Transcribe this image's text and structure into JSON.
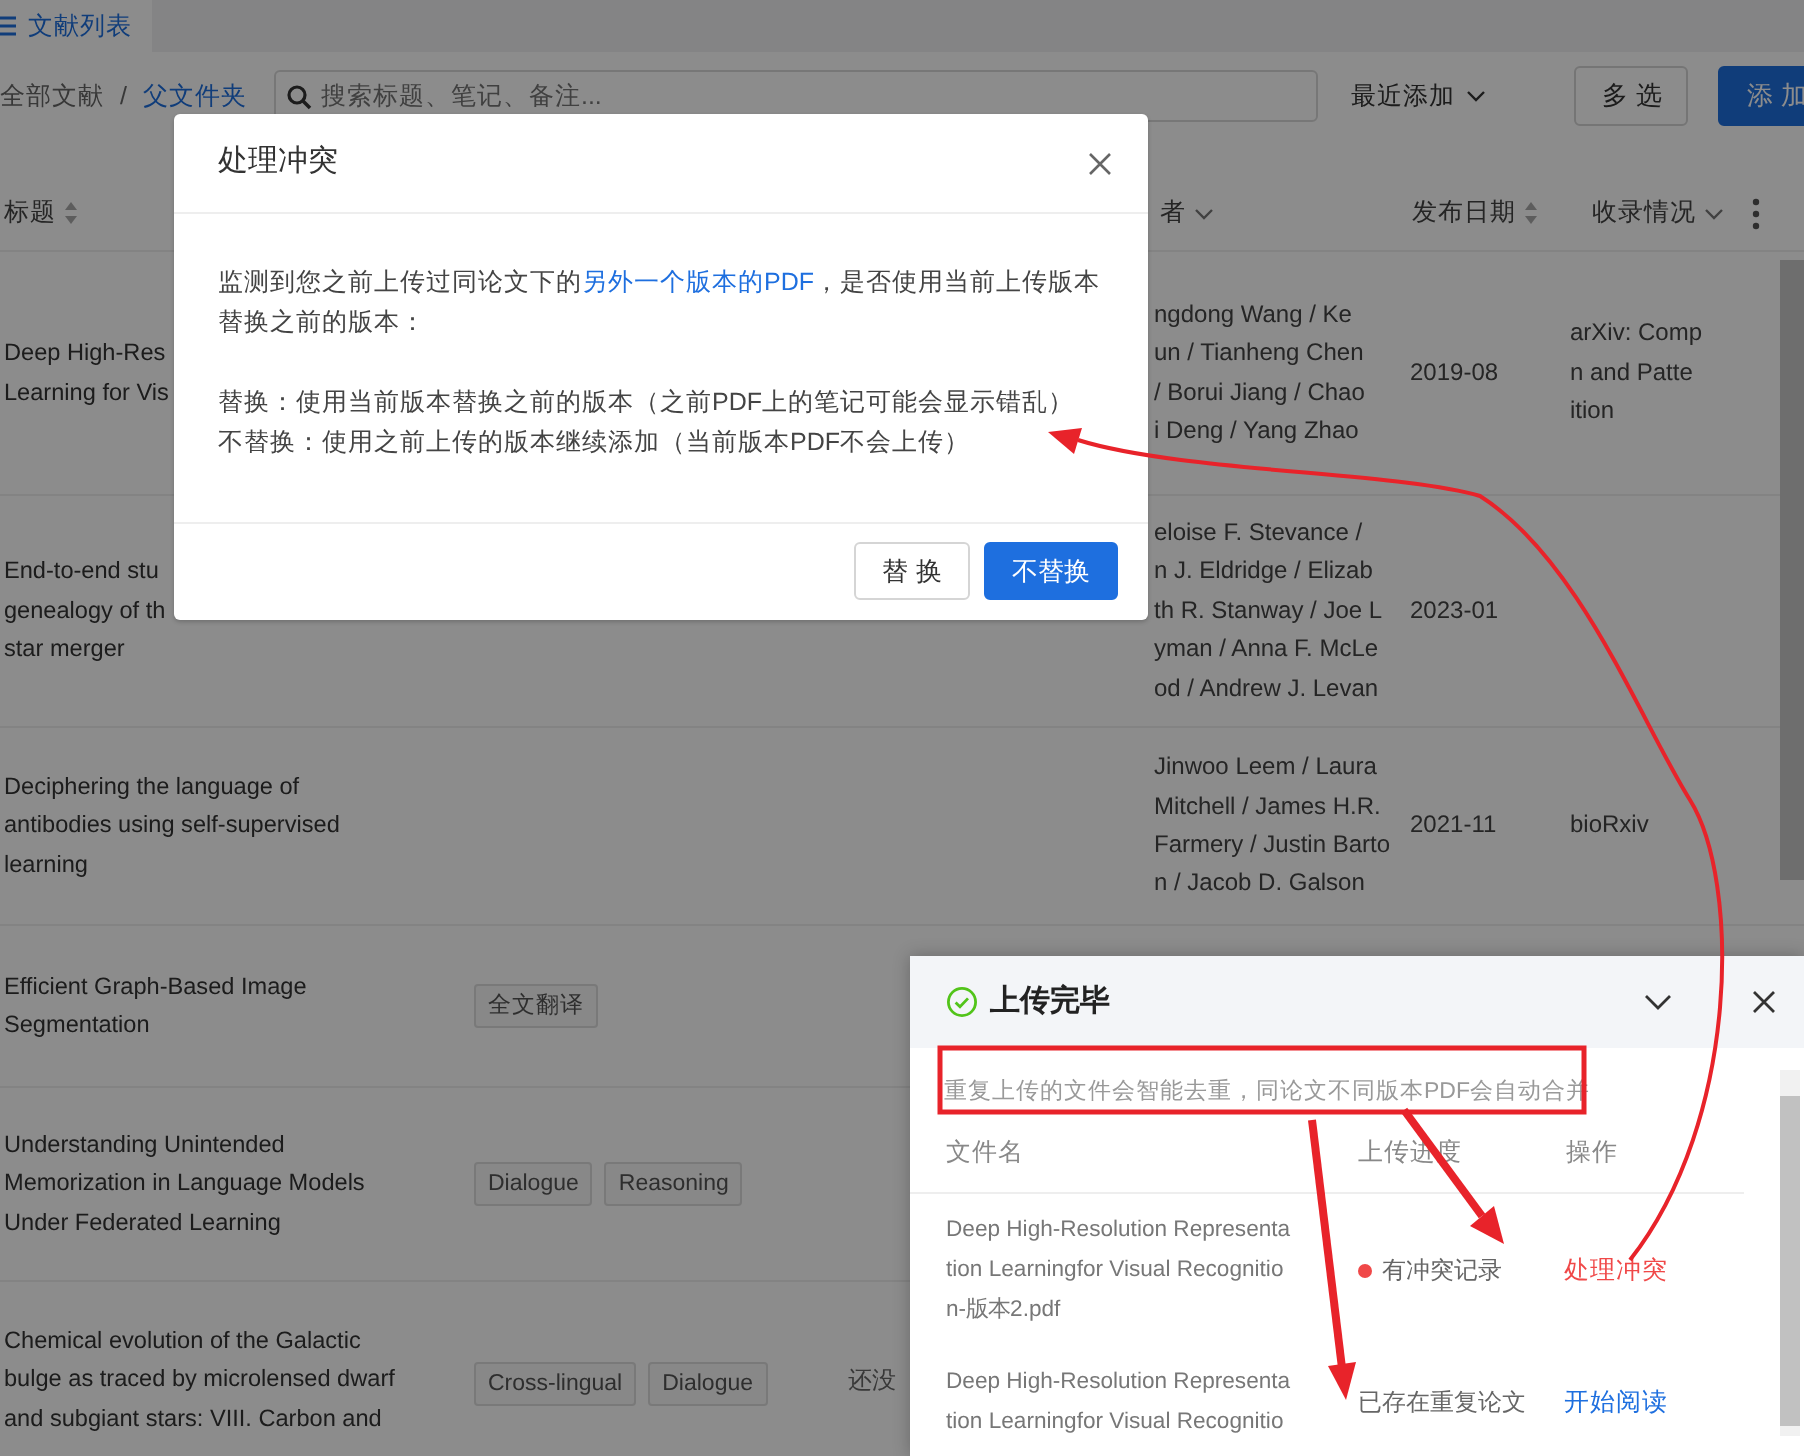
{
  "tabs": [
    {
      "label": "文献列表",
      "selected": true
    }
  ],
  "breadcrumb": {
    "separator": "/",
    "items": [
      {
        "label": "全部文献",
        "selected": false
      },
      {
        "label": "父文件夹",
        "selected": true
      }
    ]
  },
  "search": {
    "placeholder": "搜索标题、笔记、备注..."
  },
  "sort": {
    "label": "最近添加"
  },
  "buttons": [
    {
      "label": "多 选",
      "kind": "outline"
    },
    {
      "label": "添 加",
      "kind": "primary"
    }
  ],
  "table": {
    "columns": [
      {
        "label": "标题",
        "kind": "sort"
      },
      {
        "label": "者",
        "kind": "filter"
      },
      {
        "label": "发布日期",
        "kind": "sort"
      },
      {
        "label": "收录情况",
        "kind": "filter"
      }
    ],
    "rows": [
      {
        "title": [
          "Deep High-Res",
          "Learning for Vis"
        ],
        "authors": [
          "ngdong Wang / Ke",
          "un / Tianheng Chen",
          "/ Borui Jiang / Chao",
          "i Deng / Yang Zhao"
        ],
        "date": "2019-08",
        "venue": [
          "arXiv: Comp",
          "n and Patte",
          "ition"
        ]
      },
      {
        "title": [
          "End-to-end stu",
          "genealogy of th",
          "star merger"
        ],
        "authors": [
          "eloise F. Stevance /",
          "n J. Eldridge / Elizab",
          "th R. Stanway / Joe L",
          "yman / Anna F. McLe",
          "od / Andrew J. Levan"
        ],
        "date": "2023-01"
      },
      {
        "title": [
          "Deciphering the language of",
          "antibodies using self-supervised",
          "learning"
        ],
        "authors": [
          "Jinwoo Leem / Laura",
          "Mitchell / James H.R.",
          "Farmery / Justin Barto",
          "n / Jacob D. Galson"
        ],
        "date": "2021-11",
        "venue": [
          "bioRxiv"
        ]
      },
      {
        "title": [
          "Efficient Graph-Based Image",
          "Segmentation"
        ],
        "tags": [
          "全文翻译"
        ]
      },
      {
        "title": [
          "Understanding Unintended",
          "Memorization in Language Models",
          "Under Federated Learning"
        ],
        "tags": [
          "Dialogue",
          "Reasoning"
        ]
      },
      {
        "title": [
          "Chemical evolution of the Galactic",
          "bulge as traced by microlensed dwarf",
          "and subgiant stars: VIII. Carbon and"
        ],
        "tags": [
          "Cross-lingual",
          "Dialogue"
        ],
        "status": "还没"
      }
    ]
  },
  "dialog": {
    "title": "处理冲突",
    "message_before": "监测到您之前上传过同论文下的",
    "message_link": "另外一个版本的PDF",
    "message_after": "，是否使用当前上传版本替换之前的版本：",
    "options": [
      "替换：使用当前版本替换之前的版本（之前PDF上的笔记可能会显示错乱）",
      "不替换：使用之前上传的版本继续添加（当前版本PDF不会上传）"
    ],
    "buttons": [
      {
        "label": "替 换",
        "kind": "outline"
      },
      {
        "label": "不替换",
        "kind": "primary"
      }
    ]
  },
  "upload_panel": {
    "title": "上传完毕",
    "note": "重复上传的文件会智能去重，同论文不同版本PDF会自动合并",
    "columns": [
      "文件名",
      "上传进度",
      "操作"
    ],
    "rows": [
      {
        "file": [
          "Deep High-Resolution Representa",
          "tion Learningfor Visual Recognitio",
          "n-版本2.pdf"
        ],
        "status": "有冲突记录",
        "kind": "conflict",
        "action": "处理冲突"
      },
      {
        "file": [
          "Deep High-Resolution Representa",
          "tion Learningfor Visual Recognitio"
        ],
        "status": "已存在重复论文",
        "kind": "duplicate",
        "action": "开始阅读"
      }
    ]
  }
}
